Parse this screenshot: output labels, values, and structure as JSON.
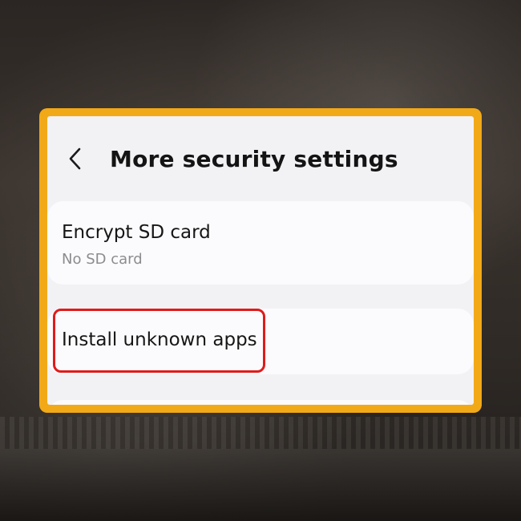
{
  "header": {
    "title": "More security settings",
    "back_icon": "chevron-left-icon"
  },
  "items": [
    {
      "title": "Encrypt SD card",
      "subtitle": "No SD card"
    },
    {
      "title": "Install unknown apps"
    }
  ],
  "colors": {
    "frame": "#f2a918",
    "highlight": "#e01b1b",
    "screen_bg": "#f2f2f5",
    "card_bg": "#fbfbfd"
  }
}
